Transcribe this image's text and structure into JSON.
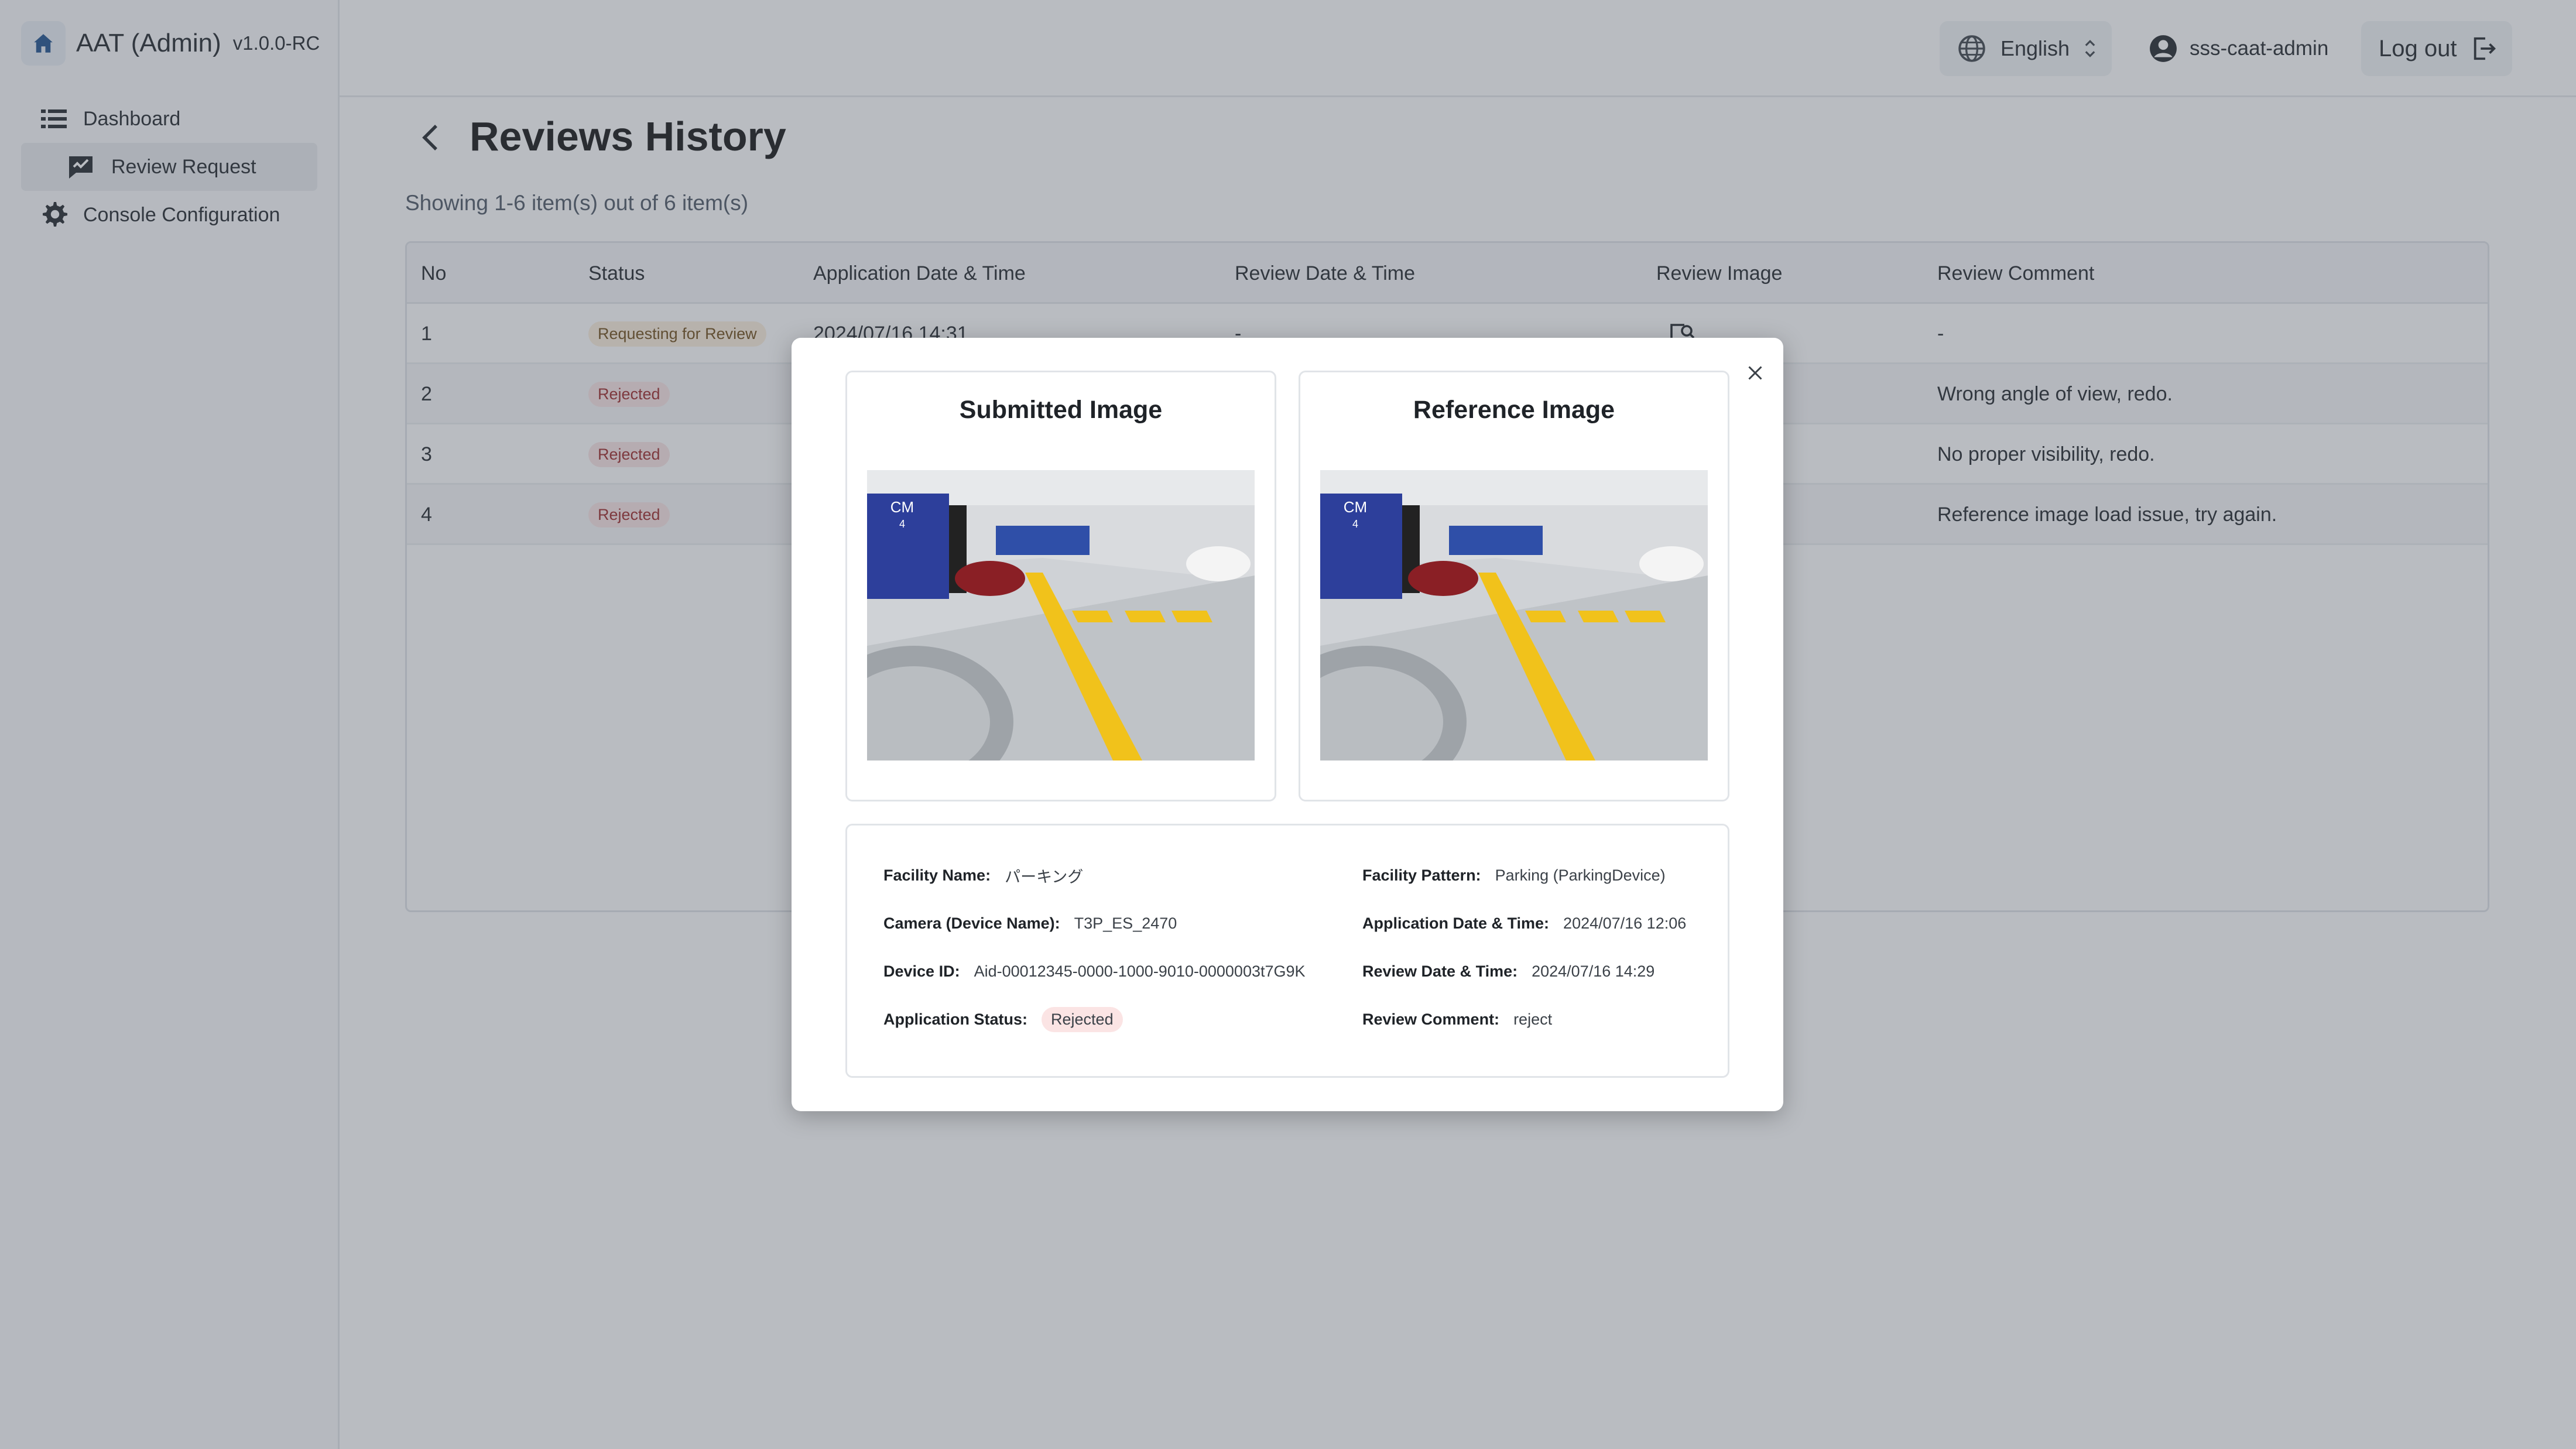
{
  "app": {
    "title": "AAT (Admin)",
    "version": "v1.0.0-RC"
  },
  "sidebar": {
    "items": [
      {
        "label": "Dashboard",
        "icon": "list-icon",
        "active": false
      },
      {
        "label": "Review Request",
        "icon": "review-request-icon",
        "active": true
      },
      {
        "label": "Console Configuration",
        "icon": "gear-icon",
        "active": false
      }
    ]
  },
  "topbar": {
    "language": "English",
    "user": "sss-caat-admin",
    "logout_label": "Log out"
  },
  "page": {
    "title": "Reviews History",
    "showing": "Showing 1-6 item(s) out of 6 item(s)"
  },
  "table": {
    "columns": [
      "No",
      "Status",
      "Application Date & Time",
      "Review Date & Time",
      "Review Image",
      "Review Comment"
    ],
    "rows": [
      {
        "no": "1",
        "status": "Requesting for Review",
        "status_kind": "pending",
        "app_date": "2024/07/16 14:31",
        "review_date": "-",
        "comment": "-"
      },
      {
        "no": "2",
        "status": "Rejected",
        "status_kind": "rejected",
        "app_date": "",
        "review_date": "",
        "comment": "Wrong angle of view, redo."
      },
      {
        "no": "3",
        "status": "Rejected",
        "status_kind": "rejected",
        "app_date": "",
        "review_date": "",
        "comment": "No proper visibility, redo."
      },
      {
        "no": "4",
        "status": "Rejected",
        "status_kind": "rejected",
        "app_date": "",
        "review_date": "",
        "comment": "Reference image load issue, try again."
      }
    ]
  },
  "modal": {
    "submitted_title": "Submitted Image",
    "reference_title": "Reference Image",
    "details": {
      "facility_name_label": "Facility Name:",
      "facility_name": "パーキング",
      "facility_pattern_label": "Facility Pattern:",
      "facility_pattern": "Parking (ParkingDevice)",
      "camera_label": "Camera (Device Name):",
      "camera": "T3P_ES_2470",
      "app_date_label": "Application Date & Time:",
      "app_date": "2024/07/16 12:06",
      "device_id_label": "Device ID:",
      "device_id": "Aid-00012345-0000-1000-9010-0000003t7G9K",
      "review_date_label": "Review Date & Time:",
      "review_date": "2024/07/16 14:29",
      "app_status_label": "Application Status:",
      "app_status": "Rejected",
      "review_comment_label": "Review Comment:",
      "review_comment": "reject"
    },
    "sign_text": "CM",
    "sign_number": "4"
  },
  "colors": {
    "accent": "#1c4f8c",
    "pending_badge_bg": "#fcefdd",
    "rejected_badge_bg": "#fbe4e4",
    "rejected_text": "#9b2626"
  }
}
